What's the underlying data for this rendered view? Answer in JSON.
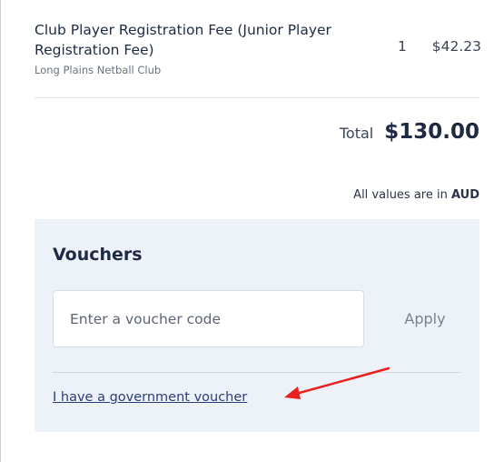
{
  "line_item": {
    "title": "Club Player Registration Fee (Junior Player Registration Fee)",
    "club": "Long Plains Netball Club",
    "quantity": "1",
    "price": "$42.23"
  },
  "totals": {
    "label": "Total",
    "value": "$130.00",
    "currency_prefix": "All values are in",
    "currency": "AUD"
  },
  "vouchers": {
    "title": "Vouchers",
    "input_placeholder": "Enter a voucher code",
    "input_value": "",
    "apply_label": "Apply",
    "gov_link": "I have a government voucher"
  },
  "colors": {
    "panel_bg": "#edf1f8",
    "link": "#2c3e7a",
    "annotation_arrow": "#e8201f"
  }
}
